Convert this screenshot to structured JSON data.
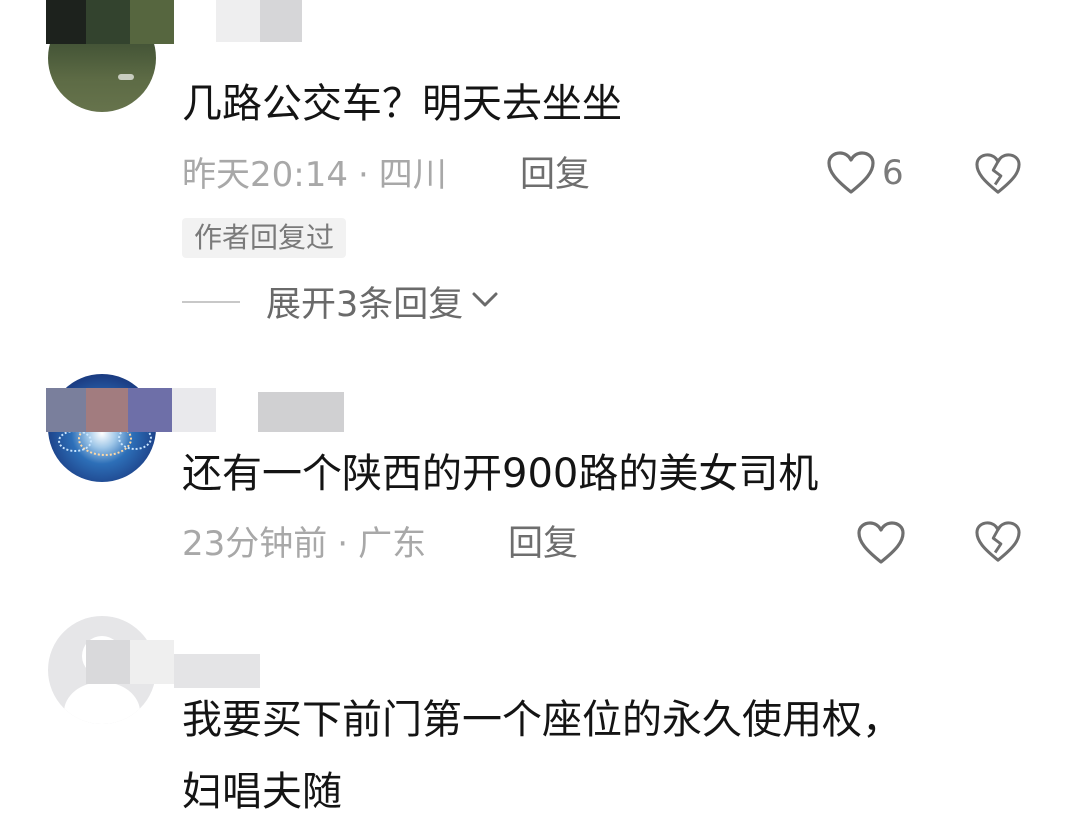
{
  "comments": [
    {
      "text": "几路公交车？明天去坐坐",
      "time": "昨天20:14",
      "location": "四川",
      "reply_label": "回复",
      "likes": "6",
      "author_tag": "作者回复过",
      "expand_label": "展开3条回复"
    },
    {
      "text": "还有一个陕西的开900路的美女司机",
      "time": "23分钟前",
      "location": "广东",
      "reply_label": "回复"
    },
    {
      "text": "我要买下前门第一个座位的永久使用权，",
      "text_cont": "妇唱夫随"
    }
  ],
  "separator": "·",
  "colors": {
    "meta_gray": "#a8a8a8",
    "reply_gray": "#6e6e6e",
    "icon_gray": "#6f6f6f"
  }
}
